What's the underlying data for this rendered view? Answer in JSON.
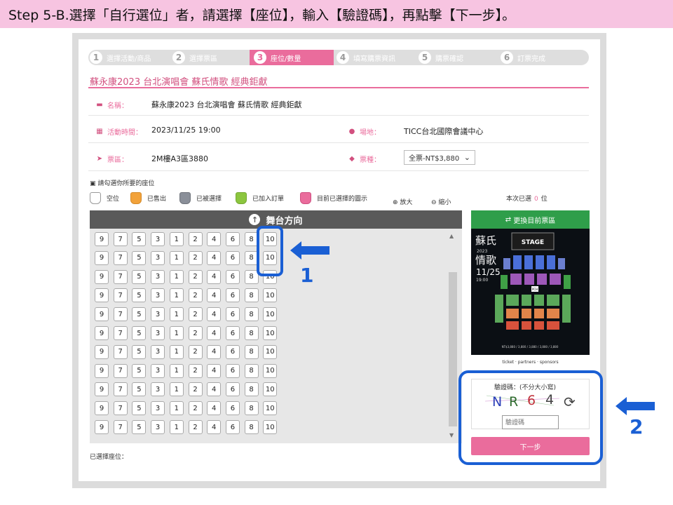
{
  "instruction": "Step 5-B.選擇「自行選位」者，請選擇【座位】，輸入【驗證碼】，再點擊【下一步】。",
  "steps": [
    {
      "num": "1",
      "label": "選擇活動/商品"
    },
    {
      "num": "2",
      "label": "選擇票區"
    },
    {
      "num": "3",
      "label": "座位/數量"
    },
    {
      "num": "4",
      "label": "填寫購票資訊"
    },
    {
      "num": "5",
      "label": "購票確認"
    },
    {
      "num": "6",
      "label": "訂票完成"
    }
  ],
  "active_step": 3,
  "event_title": "蘇永康2023 台北演唱會 蘇氏情歌 經典鉅獻",
  "info": {
    "name_label": "名稱：",
    "name_value": "蘇永康2023 台北演唱會 蘇氏情歌 經典鉅獻",
    "time_label": "活動時間：",
    "time_value": "2023/11/25 19:00",
    "venue_label": "場地：",
    "venue_value": "TICC台北國際會議中心",
    "area_label": "票區：",
    "area_value": "2M樓A3區3880",
    "type_label": "票種：",
    "type_value": "全票-NT$3,880"
  },
  "hint": "請勾選你所要的座位",
  "legend": [
    {
      "label": "空位",
      "color": "#ffffff"
    },
    {
      "label": "已售出",
      "color": "#f2a23a"
    },
    {
      "label": "已被選擇",
      "color": "#8a8f99"
    },
    {
      "label": "已加入訂單",
      "color": "#8cc63f"
    },
    {
      "label": "目前已選擇的圖示",
      "color": "#ea6c9c"
    }
  ],
  "zoom_in": "放大",
  "zoom_out": "縮小",
  "picked_prefix": "本次已選",
  "picked_count": "0",
  "picked_suffix": "位",
  "stage_direction": "舞台方向",
  "seat_numbers": [
    "9",
    "7",
    "5",
    "3",
    "1",
    "2",
    "4",
    "6",
    "8",
    "10"
  ],
  "seat_row_count": 11,
  "selected_seats_label": "已選擇座位：",
  "change_area": "更換目前票區",
  "map": {
    "title_line1": "蘇氏",
    "title_line2": "情歌",
    "year": "2023",
    "date": "11/25",
    "time": "19:00",
    "stage": "STAGE",
    "pch": "PCH",
    "prices": "NT$3,880 / 3,880 / 3,880 / 3,880 / 3,880",
    "sponsors": "ticket  ·  partners  ·  sponsors"
  },
  "captcha": {
    "label": "驗證碼：(不分大小寫)",
    "code": [
      "N",
      "R",
      "6",
      "4"
    ],
    "code_colors": [
      "#2b3fb8",
      "#2c6a2c",
      "#c0303a",
      "#444444"
    ],
    "placeholder": "驗證碼"
  },
  "next_button": "下一步",
  "callouts": {
    "one": "1",
    "two": "2"
  }
}
